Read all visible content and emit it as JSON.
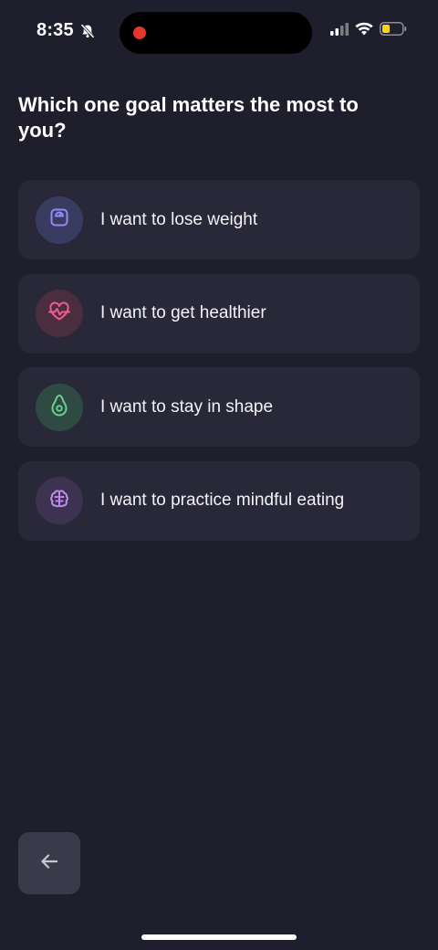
{
  "status_bar": {
    "time": "8:35",
    "icons": [
      "bell-slash-icon",
      "signal-icon",
      "wifi-icon",
      "battery-low-icon"
    ],
    "battery_color": "#f5d90a",
    "record_dot_color": "#e5362b"
  },
  "question": {
    "title": "Which one goal matters the most to you?"
  },
  "options": [
    {
      "label": "I want to lose weight",
      "icon": "scale-icon",
      "icon_color": "#8f8cf5",
      "icon_bg": "#3a3b61"
    },
    {
      "label": "I want to get healthier",
      "icon": "heart-pulse-icon",
      "icon_color": "#f25c8a",
      "icon_bg": "#4a2d3f"
    },
    {
      "label": "I want to stay in shape",
      "icon": "avocado-icon",
      "icon_color": "#66d08c",
      "icon_bg": "#2e4a42"
    },
    {
      "label": "I want to practice mindful eating",
      "icon": "brain-icon",
      "icon_color": "#c18bf0",
      "icon_bg": "#3d3250"
    }
  ],
  "navigation": {
    "back_icon": "arrow-left-icon"
  },
  "colors": {
    "background": "#1e1e2d",
    "card": "#282839",
    "back_button": "#3a3a4a"
  }
}
